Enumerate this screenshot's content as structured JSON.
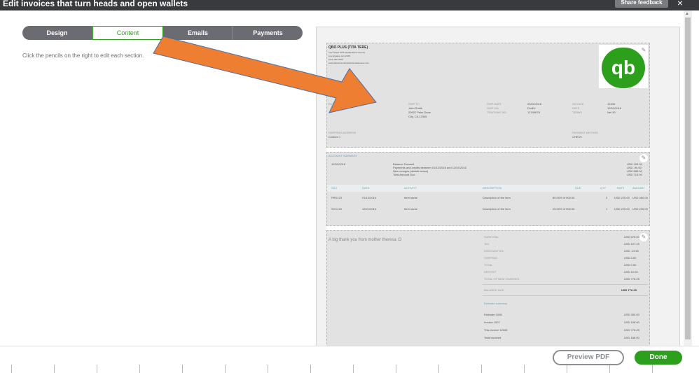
{
  "header": {
    "title": "Edit invoices that turn heads and open wallets",
    "feedback_label": "Share feedback",
    "close_label": "×"
  },
  "tabs": [
    "Design",
    "Content",
    "Emails",
    "Payments"
  ],
  "active_tab": "Content",
  "hint": "Click the pencils on the right to edit each section.",
  "invoice": {
    "company_name": "QBO PLUS (TITA TERE)",
    "company_lines": [
      "Your Street 1234 Headquarters Avenue",
      "Los Angeles, AA 12345",
      "(123) 456-7890",
      "www.qboaccountantsolutionsawesome.com"
    ],
    "logo_text": "qb",
    "invoice_label": "INVOICE",
    "bill_to_label": "BILL TO",
    "ship_to_label": "SHIP TO",
    "ship_to_lines": [
      "John Smith",
      "20637 Palm Drive",
      "City, CA 12345"
    ],
    "ship_date_label": "SHIP DATE",
    "ship_date": "03/01/2016",
    "ship_via_label": "SHIP VIA",
    "ship_via": "FedEx",
    "tracking_label": "TRACKING NO.",
    "tracking": "12345678",
    "invoice_no_label": "INVOICE",
    "invoice_no": "12345",
    "date_label": "DATE",
    "date": "12/01/2016",
    "terms_label": "TERMS",
    "terms": "Net 30",
    "shipping_address_label": "SHIPPING ADDRESS",
    "shipping_address": "Custom 1",
    "payment_method_label": "PAYMENT METHOD",
    "payment_method": "CHECK",
    "account_summary_label": "ACCOUNT SUMMARY",
    "summary_date": "12/01/2016",
    "summary_lines": [
      "Balance Forward",
      "Payments and credits between 01/12/2016 and 12/01/2016",
      "New charges (details below)",
      "Total Amount Due"
    ],
    "summary_amounts": [
      "USD 100.00",
      "USD -90.00",
      "USD 665.00",
      "USD 715.00"
    ],
    "line_headers": [
      "SKU",
      "DATE",
      "ACTIVITY",
      "DESCRIPTION",
      "DUE",
      "QTY",
      "RATE",
      "AMOUNT"
    ],
    "lines": [
      [
        "PRD123",
        "01/12/2016",
        "Item name",
        "Description of the item",
        "80.00% of 900.00",
        "2",
        "USD 225.00",
        "USD 450.00"
      ],
      [
        "SVC123",
        "12/01/2016",
        "Item name",
        "Description of the item",
        "25.00% of 900.00",
        "1",
        "USD 225.00",
        "USD 225.00"
      ]
    ],
    "message": "A big thank you from mother theresa :D",
    "totals": [
      [
        "SUBTOTAL",
        "USD 675.00"
      ],
      [
        "TAX",
        "USD 107.25"
      ],
      [
        "DISCOUNT 5%",
        "USD -13.50"
      ],
      [
        "SHIPPING",
        "USD 3.00"
      ],
      [
        "TOTAL",
        "USD 0.00"
      ],
      [
        "DEPOSIT",
        "USD 10.00"
      ],
      [
        "TOTAL OF NEW CHARGES",
        "USD 776.25"
      ]
    ],
    "balance_due_label": "BALANCE DUE",
    "balance_due": "USD 776.25",
    "estimate_summary_label": "Estimate summary",
    "estimate_rows": [
      [
        "Estimate 1008",
        "USD 300.00"
      ],
      [
        "Invoice 1007",
        "USD 108.00"
      ],
      [
        "This invoice 12345",
        "USD 776.25"
      ],
      [
        "Total invoiced",
        "USD 188.00"
      ]
    ]
  },
  "footer": {
    "preview_label": "Preview PDF",
    "done_label": "Done"
  },
  "colors": {
    "accent": "#2ca01c",
    "arrow": "#ee7e32",
    "topbar": "#393a3d"
  }
}
